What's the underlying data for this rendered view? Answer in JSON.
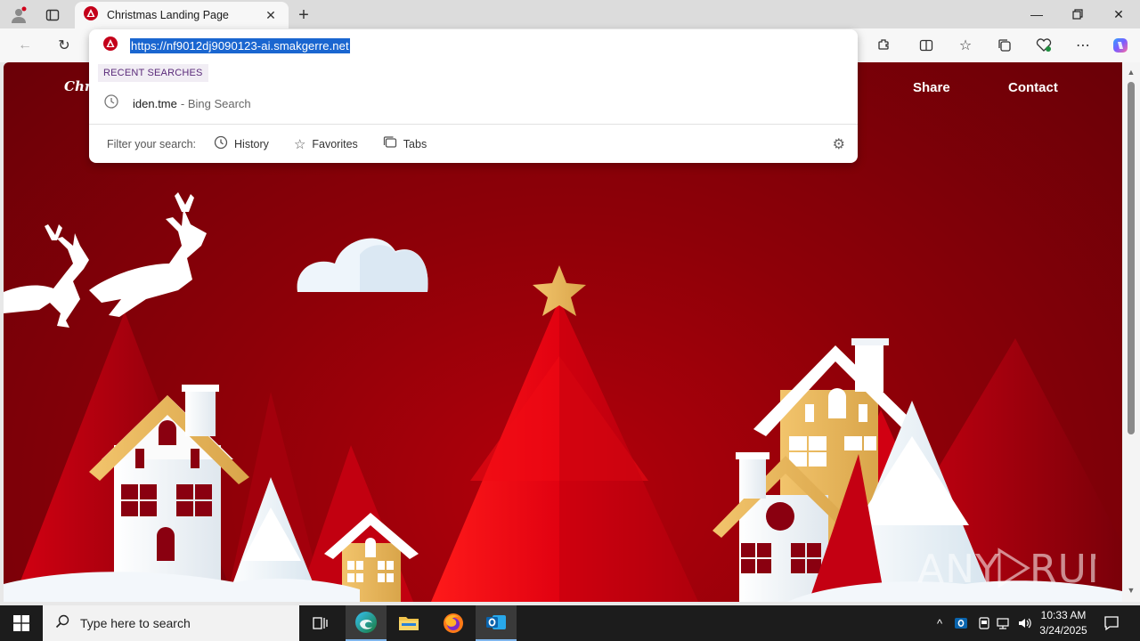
{
  "browser": {
    "tab_title": "Christmas Landing Page",
    "url": "https://nf9012dj9090123-ai.smakgerre.net"
  },
  "omnibox": {
    "recent_label": "RECENT SEARCHES",
    "recent_term": "iden.tme",
    "recent_suffix": "- Bing Search",
    "filter_label": "Filter your search:",
    "filters": [
      "History",
      "Favorites",
      "Tabs"
    ]
  },
  "page": {
    "brand": "Chri",
    "nav": [
      "Share",
      "Contact"
    ]
  },
  "watermark": "ANY RUN",
  "taskbar": {
    "search_placeholder": "Type here to search",
    "time": "10:33 AM",
    "date": "3/24/2025"
  },
  "colors": {
    "page_red": "#8e0008",
    "selection_blue": "#1a66d0",
    "taskbar": "#1c1c1c"
  }
}
